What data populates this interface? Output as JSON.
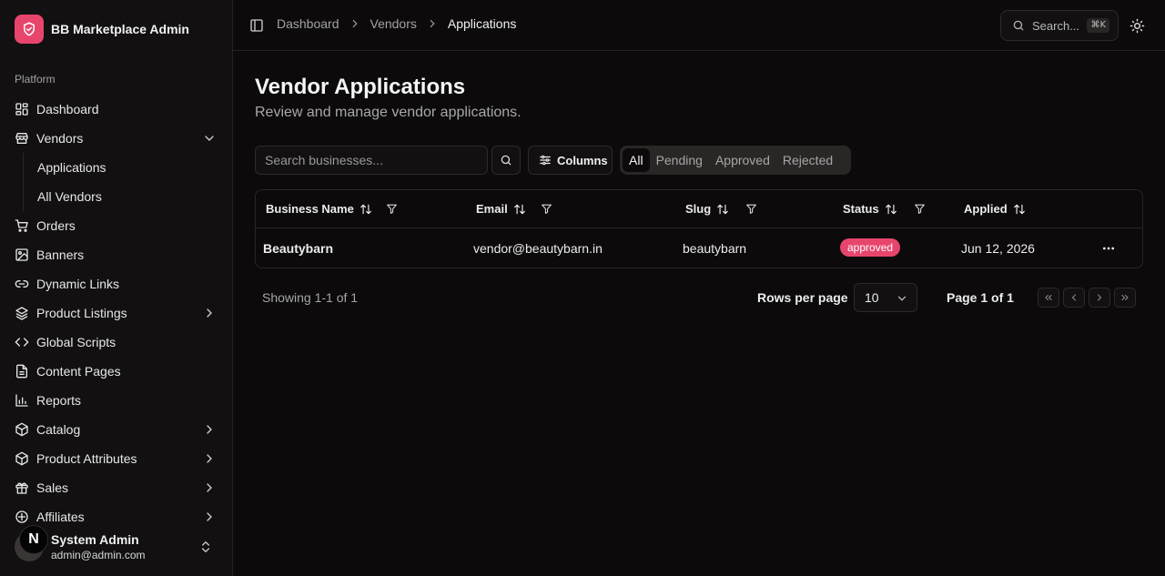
{
  "app": {
    "name": "BB Marketplace Admin",
    "accent": "#e8456d"
  },
  "sidebar": {
    "group_label": "Platform",
    "items": [
      {
        "label": "Dashboard",
        "icon": "dashboard-icon"
      },
      {
        "label": "Vendors",
        "icon": "store-icon",
        "expanded": true,
        "children": [
          {
            "label": "Applications"
          },
          {
            "label": "All Vendors"
          }
        ]
      },
      {
        "label": "Orders",
        "icon": "cart-icon"
      },
      {
        "label": "Banners",
        "icon": "image-icon"
      },
      {
        "label": "Dynamic Links",
        "icon": "link-icon"
      },
      {
        "label": "Product Listings",
        "icon": "layers-icon",
        "has_children": true
      },
      {
        "label": "Global Scripts",
        "icon": "code-icon"
      },
      {
        "label": "Content Pages",
        "icon": "file-text-icon"
      },
      {
        "label": "Reports",
        "icon": "bar-chart-icon"
      },
      {
        "label": "Catalog",
        "icon": "package-icon",
        "has_children": true
      },
      {
        "label": "Product Attributes",
        "icon": "package-icon",
        "has_children": true
      },
      {
        "label": "Sales",
        "icon": "gift-icon",
        "has_children": true
      },
      {
        "label": "Affiliates",
        "icon": "badge-icon",
        "has_children": true
      }
    ]
  },
  "user": {
    "initial": "N",
    "name": "System Admin",
    "email": "admin@admin.com"
  },
  "header": {
    "breadcrumb": [
      "Dashboard",
      "Vendors",
      "Applications"
    ],
    "search_label": "Search...",
    "search_shortcut": "⌘K"
  },
  "page": {
    "title": "Vendor Applications",
    "subtitle": "Review and manage vendor applications."
  },
  "toolbar": {
    "search_placeholder": "Search businesses...",
    "columns_label": "Columns",
    "tabs": [
      "All",
      "Pending",
      "Approved",
      "Rejected"
    ],
    "active_tab": "All"
  },
  "table": {
    "columns": [
      "Business Name",
      "Email",
      "Slug",
      "Status",
      "Applied"
    ],
    "rows": [
      {
        "business_name": "Beautybarn",
        "email": "vendor@beautybarn.in",
        "slug": "beautybarn",
        "status": "approved",
        "applied": "Jun 12, 2026"
      }
    ]
  },
  "pagination": {
    "showing": "Showing 1-1 of 1",
    "rows_per_page_label": "Rows per page",
    "rows_per_page_value": "10",
    "page_info": "Page 1 of 1"
  }
}
